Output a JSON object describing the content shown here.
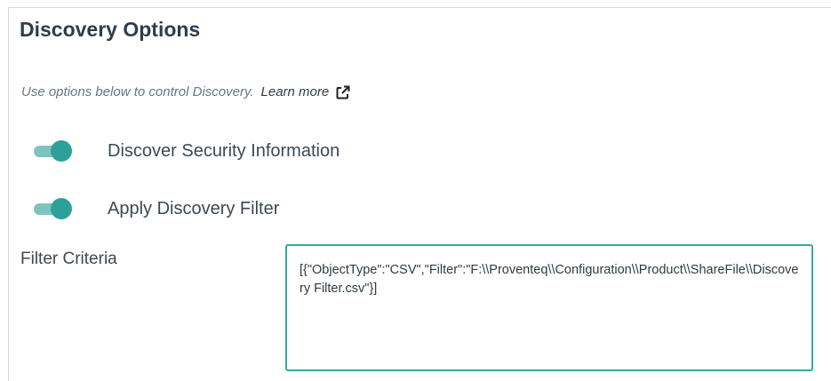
{
  "title": "Discovery Options",
  "description": {
    "hint": "Use options below to control Discovery.",
    "learn_more": "Learn more",
    "learn_more_icon": "external-link-icon"
  },
  "toggles": [
    {
      "label": "Discover Security Information",
      "on": true
    },
    {
      "label": "Apply Discovery Filter",
      "on": true
    }
  ],
  "filter": {
    "label": "Filter Criteria",
    "value": "[{\"ObjectType\":\"CSV\",\"Filter\":\"F:\\\\Proventeq\\\\Configuration\\\\Product\\\\ShareFile\\\\Discovery Filter.csv\"}]"
  },
  "colors": {
    "accent": "#2ea09a",
    "accent_light": "#7fc3bf",
    "title": "#2d3e4c"
  }
}
